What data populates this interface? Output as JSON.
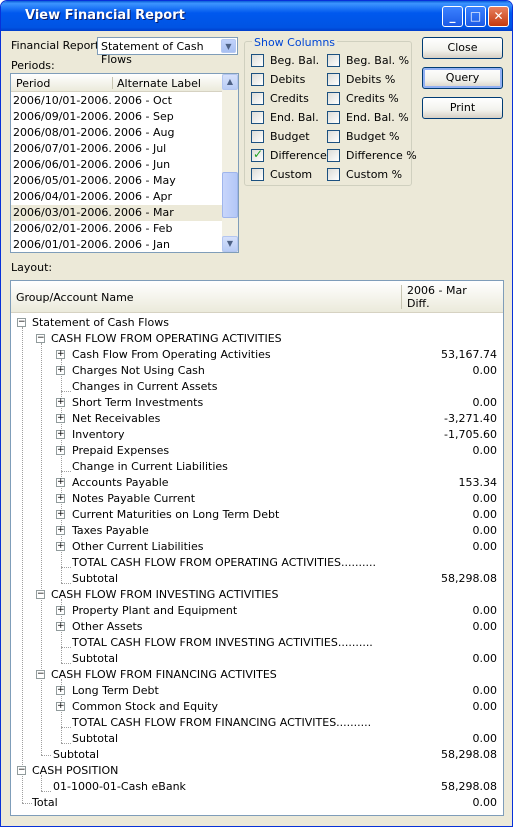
{
  "window": {
    "title": "View Financial Report"
  },
  "financial_report": {
    "label": "Financial Report:",
    "value": "Statement of Cash Flows"
  },
  "periods": {
    "label": "Periods:",
    "columns": [
      "Period",
      "Alternate Label"
    ],
    "rows": [
      {
        "period": "2006/10/01-2006...",
        "label": "2006 - Oct"
      },
      {
        "period": "2006/09/01-2006...",
        "label": "2006 - Sep"
      },
      {
        "period": "2006/08/01-2006...",
        "label": "2006 - Aug"
      },
      {
        "period": "2006/07/01-2006...",
        "label": "2006 - Jul"
      },
      {
        "period": "2006/06/01-2006...",
        "label": "2006 - Jun"
      },
      {
        "period": "2006/05/01-2006...",
        "label": "2006 - May"
      },
      {
        "period": "2006/04/01-2006...",
        "label": "2006 - Apr"
      },
      {
        "period": "2006/03/01-2006...",
        "label": "2006 - Mar"
      },
      {
        "period": "2006/02/01-2006...",
        "label": "2006 - Feb"
      },
      {
        "period": "2006/01/01-2006...",
        "label": "2006 - Jan"
      }
    ]
  },
  "show_columns": {
    "title": "Show Columns",
    "left": [
      {
        "label": "Beg. Bal.",
        "checked": false
      },
      {
        "label": "Debits",
        "checked": false
      },
      {
        "label": "Credits",
        "checked": false
      },
      {
        "label": "End. Bal.",
        "checked": false
      },
      {
        "label": "Budget",
        "checked": false
      },
      {
        "label": "Difference",
        "checked": true
      },
      {
        "label": "Custom",
        "checked": false
      }
    ],
    "right": [
      {
        "label": "Beg. Bal. %",
        "checked": false
      },
      {
        "label": "Debits %",
        "checked": false
      },
      {
        "label": "Credits %",
        "checked": false
      },
      {
        "label": "End. Bal. %",
        "checked": false
      },
      {
        "label": "Budget %",
        "checked": false
      },
      {
        "label": "Difference %",
        "checked": false
      },
      {
        "label": "Custom %",
        "checked": false
      }
    ]
  },
  "buttons": {
    "close": "Close",
    "query": "Query",
    "print": "Print"
  },
  "layout": {
    "label": "Layout:",
    "col_name": "Group/Account Name",
    "col_period": "2006 - Mar",
    "col_type": "Diff.",
    "rows": [
      {
        "text": "Statement of Cash Flows",
        "value": ""
      },
      {
        "text": "CASH FLOW FROM OPERATING ACTIVITIES",
        "value": ""
      },
      {
        "text": "Cash Flow From Operating Activities",
        "value": "53,167.74"
      },
      {
        "text": "Charges Not Using Cash",
        "value": "0.00"
      },
      {
        "text": "Changes in Current Assets",
        "value": ""
      },
      {
        "text": "Short Term Investments",
        "value": "0.00"
      },
      {
        "text": "Net Receivables",
        "value": "-3,271.40"
      },
      {
        "text": "Inventory",
        "value": "-1,705.60"
      },
      {
        "text": "Prepaid Expenses",
        "value": "0.00"
      },
      {
        "text": "Change in Current Liabilities",
        "value": ""
      },
      {
        "text": "Accounts Payable",
        "value": "153.34"
      },
      {
        "text": "Notes Payable Current",
        "value": "0.00"
      },
      {
        "text": "Current Maturities on Long Term Debt",
        "value": "0.00"
      },
      {
        "text": "Taxes Payable",
        "value": "0.00"
      },
      {
        "text": "Other Current Liabilities",
        "value": "0.00"
      },
      {
        "text": "TOTAL CASH FLOW FROM OPERATING ACTIVITIES..........",
        "value": ""
      },
      {
        "text": "Subtotal",
        "value": "58,298.08"
      },
      {
        "text": "CASH FLOW FROM INVESTING ACTIVITIES",
        "value": ""
      },
      {
        "text": "Property Plant and Equipment",
        "value": "0.00"
      },
      {
        "text": "Other Assets",
        "value": "0.00"
      },
      {
        "text": "TOTAL CASH FLOW FROM INVESTING ACTIVITIES..........",
        "value": ""
      },
      {
        "text": "Subtotal",
        "value": "0.00"
      },
      {
        "text": "CASH FLOW FROM FINANCING ACTIVITES",
        "value": ""
      },
      {
        "text": "Long Term Debt",
        "value": "0.00"
      },
      {
        "text": "Common Stock and Equity",
        "value": "0.00"
      },
      {
        "text": "TOTAL CASH FLOW FROM FINANCING ACTIVITES..........",
        "value": ""
      },
      {
        "text": "Subtotal",
        "value": "0.00"
      },
      {
        "text": "Subtotal",
        "value": "58,298.08"
      },
      {
        "text": "CASH POSITION",
        "value": ""
      },
      {
        "text": "01-1000-01-Cash eBank",
        "value": "58,298.08"
      },
      {
        "text": "Total",
        "value": "0.00"
      }
    ]
  }
}
